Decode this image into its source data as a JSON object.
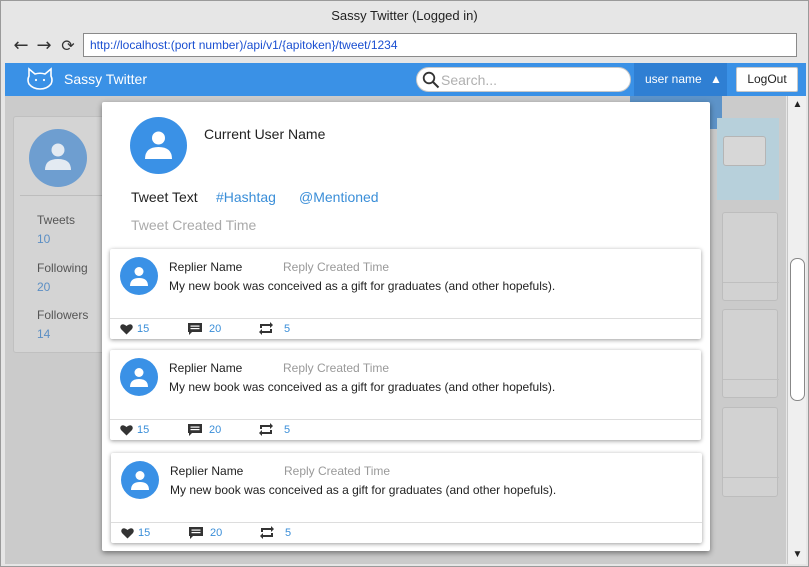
{
  "window": {
    "title": "Sassy Twitter (Logged in)"
  },
  "browser": {
    "back_icon": "arrow-left-icon",
    "forward_icon": "arrow-right-icon",
    "reload_icon": "reload-icon",
    "url": "http://localhost:(port number)/api/v1/{apitoken}/tweet/1234"
  },
  "appbar": {
    "logo_icon": "cat-logo-icon",
    "title": "Sassy Twitter",
    "search_placeholder": "Search...",
    "user_menu_label": "user name",
    "user_menu_caret": "▲",
    "logout_label": "LogOut"
  },
  "sidebar": {
    "stats": [
      {
        "label": "Tweets",
        "value": "10"
      },
      {
        "label": "Following",
        "value": "20"
      },
      {
        "label": "Followers",
        "value": "14"
      }
    ]
  },
  "tweet": {
    "user_name": "Current User Name",
    "text": "Tweet Text",
    "hashtag": "#Hashtag",
    "mention": "@Mentioned",
    "created_time": "Tweet Created Time"
  },
  "replies": [
    {
      "name": "Replier Name",
      "time": "Reply Created Time",
      "text": "My new book was conceived as a gift for graduates (and other hopefuls).",
      "likes": "15",
      "comments": "20",
      "retweets": "5"
    },
    {
      "name": "Replier Name",
      "time": "Reply Created Time",
      "text": "My new book was conceived as a gift for graduates (and other hopefuls).",
      "likes": "15",
      "comments": "20",
      "retweets": "5"
    },
    {
      "name": "Replier Name",
      "time": "Reply Created Time",
      "text": "My new book was conceived as a gift for graduates (and other hopefuls).",
      "likes": "15",
      "comments": "20",
      "retweets": "5"
    }
  ],
  "colors": {
    "accent": "#3a91e6",
    "link": "#3a8ed8",
    "muted_text": "#aaaaaa"
  }
}
